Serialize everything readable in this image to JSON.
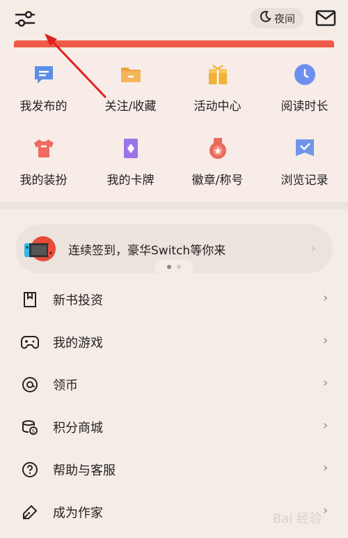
{
  "header": {
    "night_mode_label": "夜间",
    "icons": {
      "settings": "sliders-icon",
      "night": "moon-icon",
      "mail": "mail-icon"
    }
  },
  "grid": [
    {
      "label": "我发布的",
      "icon": "message-icon",
      "color": "#5b8fe6"
    },
    {
      "label": "关注/收藏",
      "icon": "folder-icon",
      "color": "#f0a240"
    },
    {
      "label": "活动中心",
      "icon": "gift-icon",
      "color": "#f2b13a"
    },
    {
      "label": "阅读时长",
      "icon": "clock-icon",
      "color": "#6f8ff0"
    },
    {
      "label": "我的装扮",
      "icon": "shirt-icon",
      "color": "#ef6a60"
    },
    {
      "label": "我的卡牌",
      "icon": "card-icon",
      "color": "#9b73e8"
    },
    {
      "label": "徽章/称号",
      "icon": "medal-icon",
      "color": "#e86a5c"
    },
    {
      "label": "浏览记录",
      "icon": "history-icon",
      "color": "#6f96e8"
    }
  ],
  "signin_banner": {
    "text": "连续签到，豪华Switch等你来",
    "chevron": "›"
  },
  "menu": [
    {
      "label": "新书投资",
      "icon": "bookmark-icon",
      "chevron": "›"
    },
    {
      "label": "我的游戏",
      "icon": "gamepad-icon",
      "chevron": "›"
    },
    {
      "label": "领币",
      "icon": "coin-icon",
      "chevron": "›"
    },
    {
      "label": "积分商城",
      "icon": "points-icon",
      "chevron": "›"
    },
    {
      "label": "帮助与客服",
      "icon": "help-icon",
      "chevron": "›"
    },
    {
      "label": "成为作家",
      "icon": "pen-icon",
      "chevron": "›"
    }
  ],
  "watermark": {
    "text": "Bai 经验"
  },
  "colors": {
    "background": "#f6ece6",
    "banner_red": "#ef5a48",
    "annotation_arrow": "#e02020"
  }
}
